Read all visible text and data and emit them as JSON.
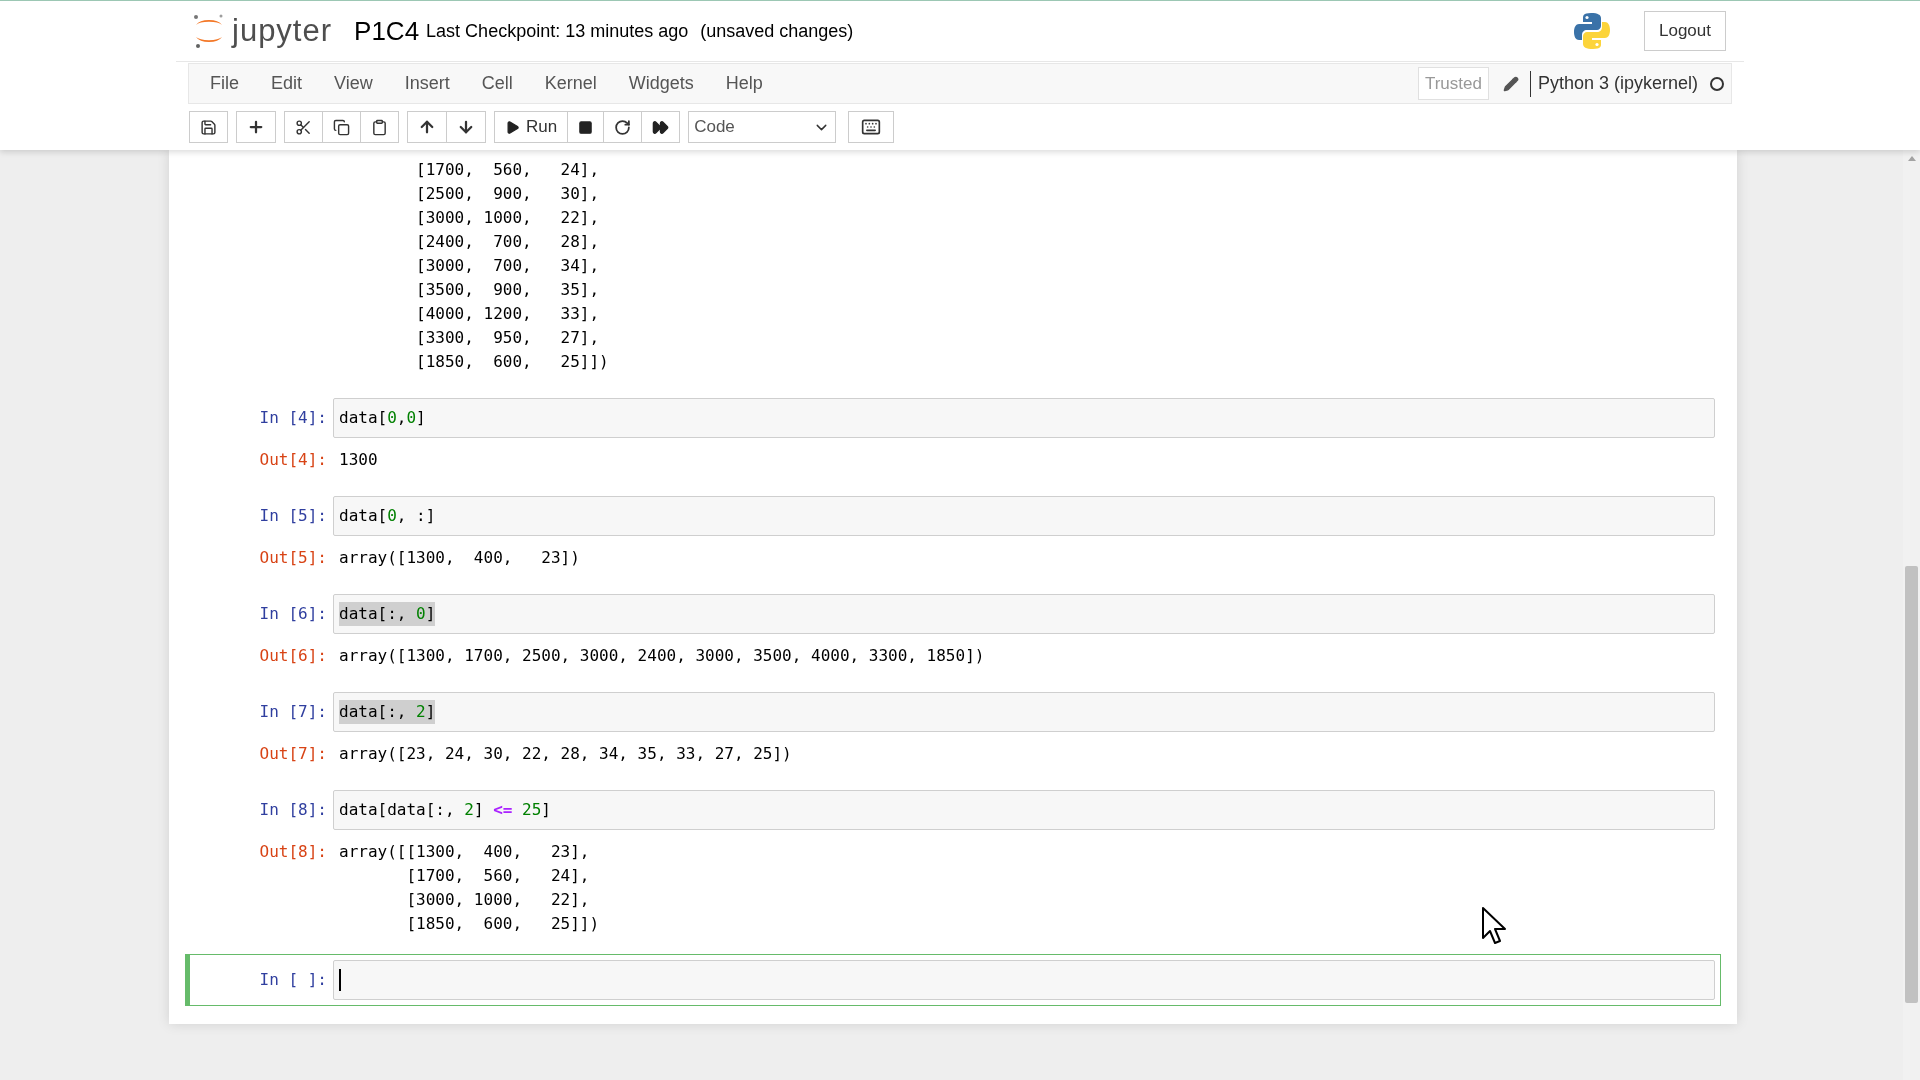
{
  "header": {
    "logo_text": "jupyter",
    "notebook_name": "P1C4",
    "checkpoint": "Last Checkpoint: 13 minutes ago",
    "save_status": "(unsaved changes)",
    "logout": "Logout"
  },
  "menu": [
    "File",
    "Edit",
    "View",
    "Insert",
    "Cell",
    "Kernel",
    "Widgets",
    "Help"
  ],
  "indicators": {
    "trusted": "Trusted",
    "kernel_name": "Python 3 (ipykernel)",
    "kernel_busy": false
  },
  "toolbar": {
    "run_label": "Run",
    "cell_type": "Code"
  },
  "cells": [
    {
      "active": false,
      "output": "        [1700,  560,   24],\n        [2500,  900,   30],\n        [3000, 1000,   22],\n        [2400,  700,   28],\n        [3000,  700,   34],\n        [3500,  900,   35],\n        [4000, 1200,   33],\n        [3300,  950,   27],\n        [1850,  600,   25]])"
    },
    {
      "active": false,
      "prompt_in": "In [4]:",
      "highlighted": false,
      "code": [
        {
          "kind": "plain",
          "text": "data["
        },
        {
          "kind": "number",
          "text": "0"
        },
        {
          "kind": "plain",
          "text": ","
        },
        {
          "kind": "number",
          "text": "0"
        },
        {
          "kind": "plain",
          "text": "]"
        }
      ],
      "prompt_out": "Out[4]:",
      "output": "1300"
    },
    {
      "active": false,
      "prompt_in": "In [5]:",
      "highlighted": false,
      "code": [
        {
          "kind": "plain",
          "text": "data["
        },
        {
          "kind": "number",
          "text": "0"
        },
        {
          "kind": "plain",
          "text": ", :]"
        }
      ],
      "prompt_out": "Out[5]:",
      "output": "array([1300,  400,   23])"
    },
    {
      "active": false,
      "prompt_in": "In [6]:",
      "highlighted": true,
      "code": [
        {
          "kind": "plain",
          "text": "data[:, "
        },
        {
          "kind": "number",
          "text": "0"
        },
        {
          "kind": "plain",
          "text": "]"
        }
      ],
      "prompt_out": "Out[6]:",
      "output": "array([1300, 1700, 2500, 3000, 2400, 3000, 3500, 4000, 3300, 1850])"
    },
    {
      "active": false,
      "prompt_in": "In [7]:",
      "highlighted": true,
      "code": [
        {
          "kind": "plain",
          "text": "data[:, "
        },
        {
          "kind": "number",
          "text": "2"
        },
        {
          "kind": "plain",
          "text": "]"
        }
      ],
      "prompt_out": "Out[7]:",
      "output": "array([23, 24, 30, 22, 28, 34, 35, 33, 27, 25])"
    },
    {
      "active": false,
      "prompt_in": "In [8]:",
      "highlighted": false,
      "code": [
        {
          "kind": "plain",
          "text": "data[data[:, "
        },
        {
          "kind": "number",
          "text": "2"
        },
        {
          "kind": "plain",
          "text": "] "
        },
        {
          "kind": "operator",
          "text": "<= "
        },
        {
          "kind": "number",
          "text": "25"
        },
        {
          "kind": "plain",
          "text": "]"
        }
      ],
      "prompt_out": "Out[8]:",
      "output": "array([[1300,  400,   23],\n       [1700,  560,   24],\n       [3000, 1000,   22],\n       [1850,  600,   25]])"
    },
    {
      "active": true,
      "prompt_in": "In [ ]:"
    }
  ]
}
